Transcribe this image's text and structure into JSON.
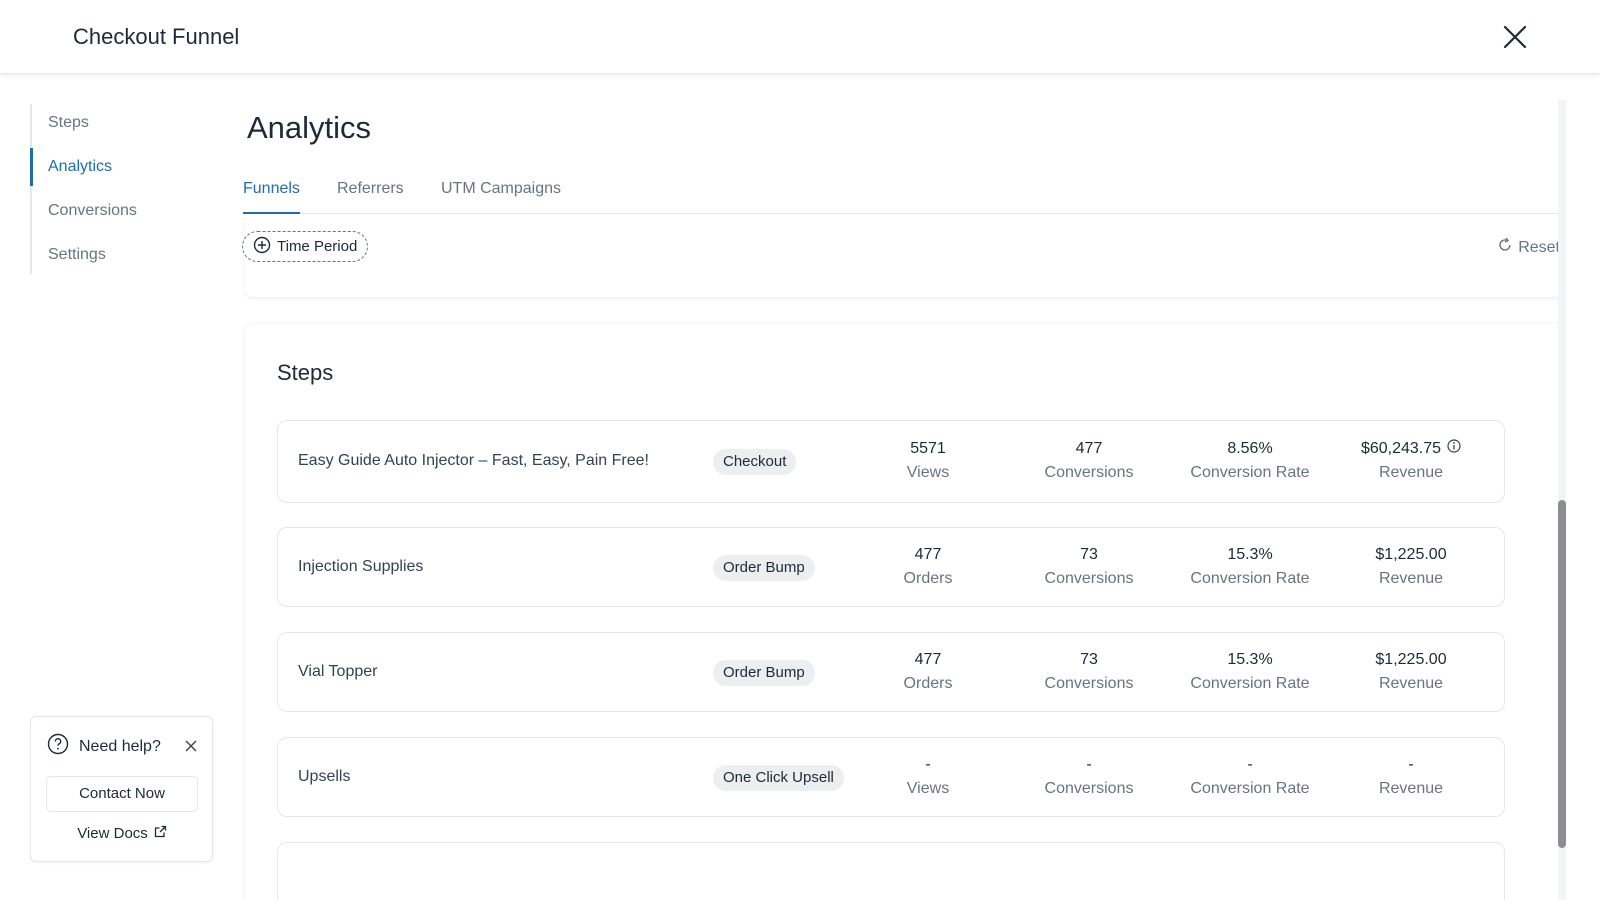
{
  "header": {
    "title": "Checkout Funnel"
  },
  "sidebar": {
    "items": [
      {
        "label": "Steps"
      },
      {
        "label": "Analytics",
        "active": true
      },
      {
        "label": "Conversions"
      },
      {
        "label": "Settings"
      }
    ]
  },
  "main": {
    "title": "Analytics",
    "tabs": [
      {
        "label": "Funnels",
        "active": true
      },
      {
        "label": "Referrers"
      },
      {
        "label": "UTM Campaigns"
      }
    ],
    "filters": {
      "time_period_label": "Time Period",
      "reset_label": "Reset"
    }
  },
  "steps": {
    "title": "Steps",
    "rows": [
      {
        "name": "Easy Guide Auto Injector – Fast, Easy, Pain Free!",
        "type": "Checkout",
        "metrics": [
          {
            "value": "5571",
            "label": "Views"
          },
          {
            "value": "477",
            "label": "Conversions"
          },
          {
            "value": "8.56%",
            "label": "Conversion Rate"
          },
          {
            "value": "$60,243.75",
            "label": "Revenue",
            "info": true
          }
        ]
      },
      {
        "name": "Injection Supplies",
        "type": "Order Bump",
        "metrics": [
          {
            "value": "477",
            "label": "Orders"
          },
          {
            "value": "73",
            "label": "Conversions"
          },
          {
            "value": "15.3%",
            "label": "Conversion Rate"
          },
          {
            "value": "$1,225.00",
            "label": "Revenue"
          }
        ]
      },
      {
        "name": "Vial Topper",
        "type": "Order Bump",
        "metrics": [
          {
            "value": "477",
            "label": "Orders"
          },
          {
            "value": "73",
            "label": "Conversions"
          },
          {
            "value": "15.3%",
            "label": "Conversion Rate"
          },
          {
            "value": "$1,225.00",
            "label": "Revenue"
          }
        ]
      },
      {
        "name": "Upsells",
        "type": "One Click Upsell",
        "metrics": [
          {
            "value": "-",
            "label": "Views"
          },
          {
            "value": "-",
            "label": "Conversions"
          },
          {
            "value": "-",
            "label": "Conversion Rate"
          },
          {
            "value": "-",
            "label": "Revenue"
          }
        ]
      }
    ]
  },
  "help": {
    "title": "Need help?",
    "contact_label": "Contact Now",
    "docs_label": "View Docs"
  },
  "colors": {
    "accent": "#1d6fa5",
    "badge_bg": "#eceef0",
    "border": "#e5e7eb"
  }
}
